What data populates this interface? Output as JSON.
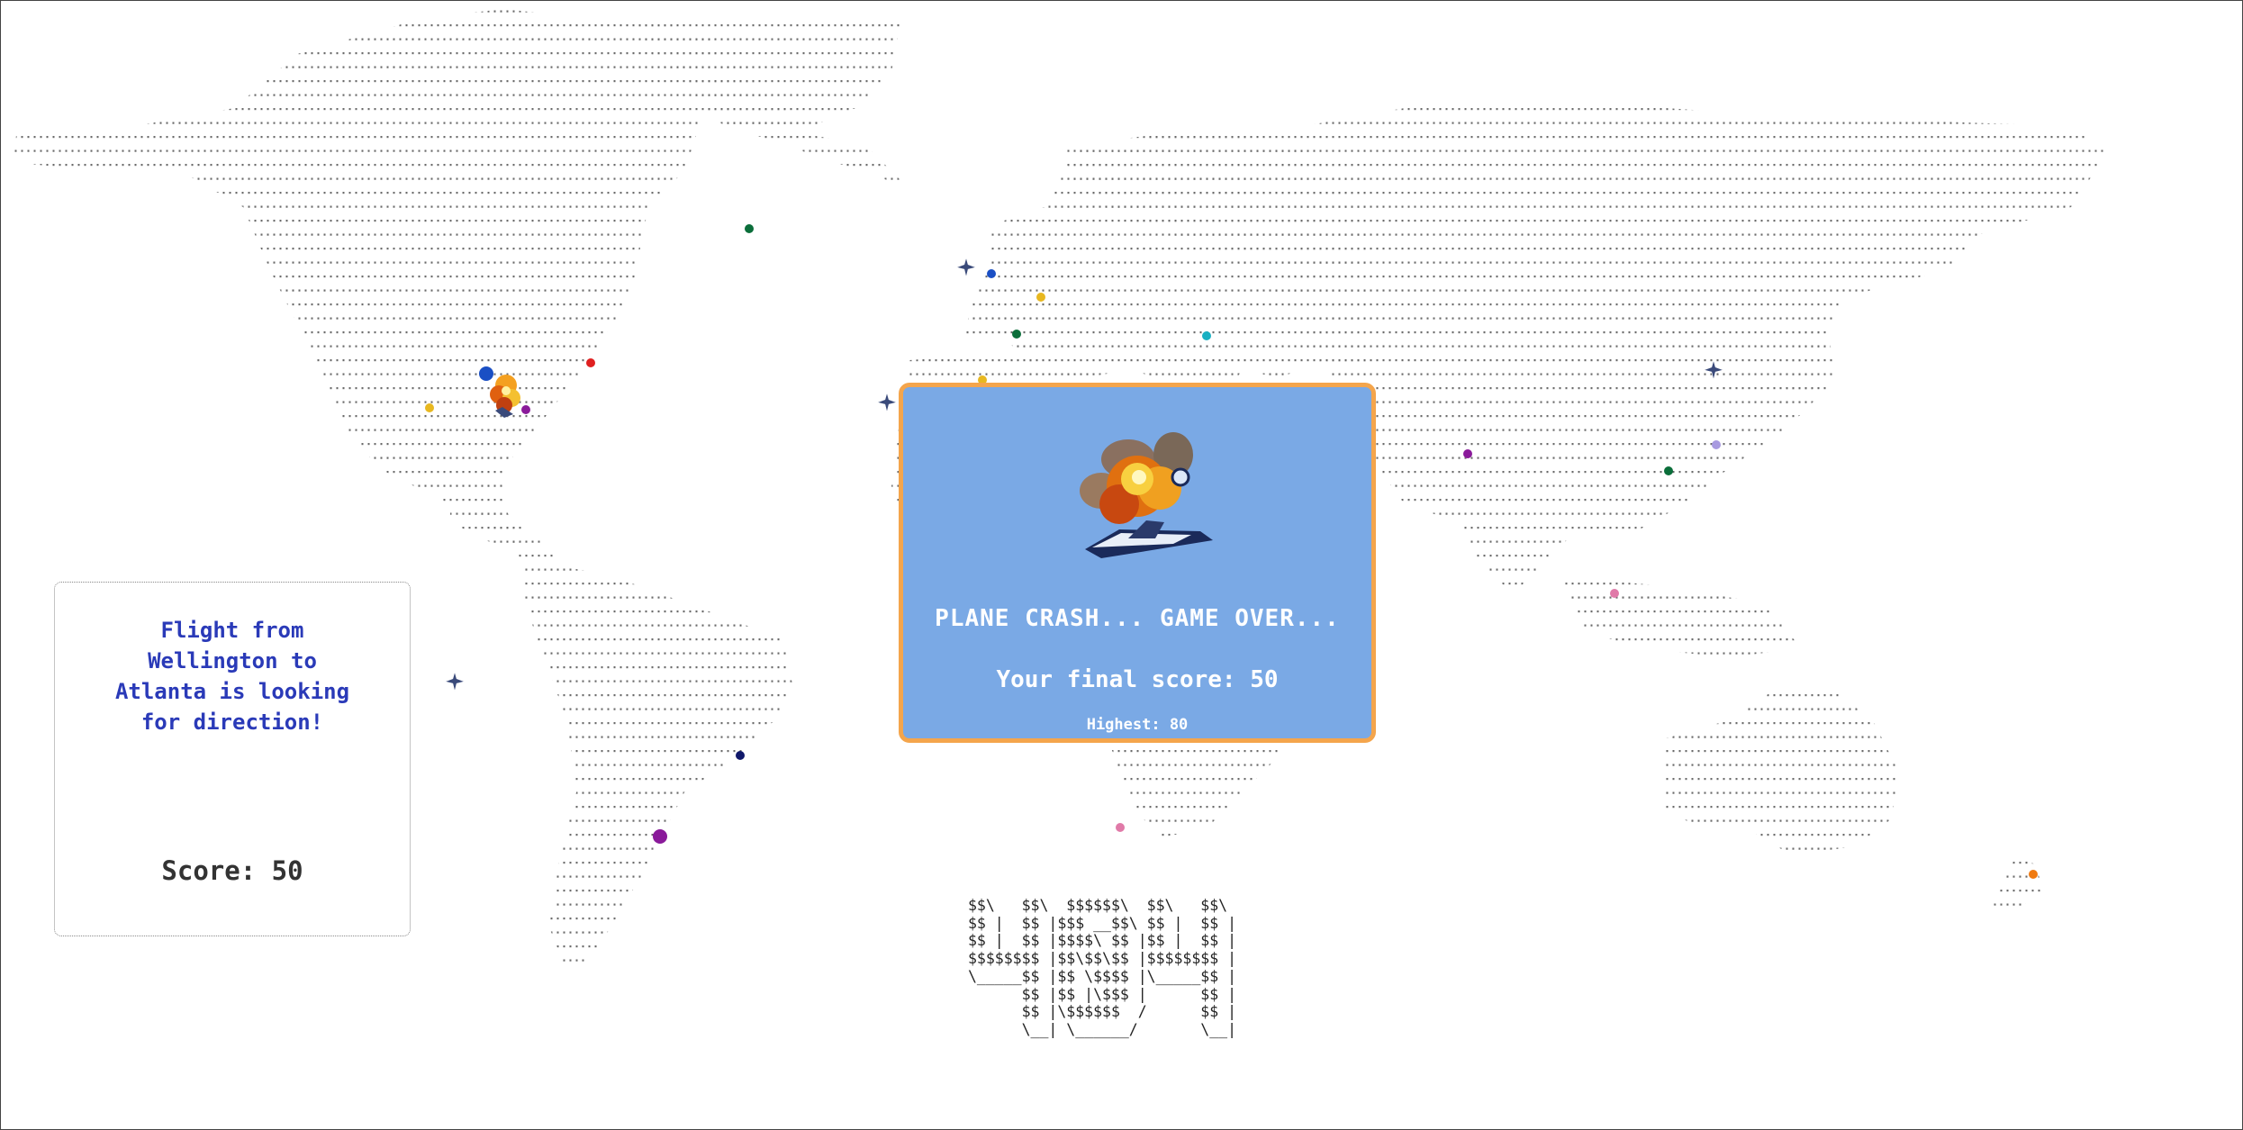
{
  "game": {
    "status_message": "Flight from\nWellington to\nAtlanta is looking\nfor direction!",
    "score_text": "Score: 50",
    "modal_title": "PLANE CRASH... GAME OVER...",
    "final_score_text": "Your final score: 50",
    "highest_text": "Highest: 80",
    "final_score": 50,
    "highest_score": 80
  },
  "ascii_banner": "$$\\   $$\\  $$$$$$\\  $$\\   $$\\\n$$ |  $$ |$$$ __$$\\ $$ |  $$ |\n$$ |  $$ |$$$$\\ $$ |$$ |  $$ |\n$$$$$$$$ |$$\\$$\\$$ |$$$$$$$$ |\n\\_____$$ |$$ \\$$$$ |\\_____$$ |\n      $$ |$$ |\\$$$ |      $$ |\n      $$ |\\$$$$$$  /      $$ |\n      \\__| \\______/       \\__|",
  "airports": [
    {
      "id": "airport-1",
      "color": "#0b6e3a"
    },
    {
      "id": "airport-2",
      "color": "#1a4fc4"
    },
    {
      "id": "airport-3",
      "color": "#e02020"
    },
    {
      "id": "airport-4",
      "color": "#e8b820"
    },
    {
      "id": "airport-5",
      "color": "#8a1a9a"
    },
    {
      "id": "airport-6",
      "color": "#1a4fc4"
    },
    {
      "id": "airport-7",
      "color": "#e8b820"
    },
    {
      "id": "airport-8",
      "color": "#0b6e3a"
    },
    {
      "id": "airport-9",
      "color": "#19b0c2"
    },
    {
      "id": "airport-10",
      "color": "#e8b820"
    },
    {
      "id": "airport-11",
      "color": "#8a1a9a"
    },
    {
      "id": "airport-12",
      "color": "#a89ae0"
    },
    {
      "id": "airport-13",
      "color": "#0b6e3a"
    },
    {
      "id": "airport-14",
      "color": "#e07aa8"
    },
    {
      "id": "airport-15",
      "color": "#10186a"
    },
    {
      "id": "airport-16",
      "color": "#8a1a9a"
    },
    {
      "id": "airport-17",
      "color": "#e07aa8"
    },
    {
      "id": "airport-18",
      "color": "#f07a10"
    }
  ],
  "icons": {
    "plane": "plane-icon",
    "explosion": "explosion-icon"
  },
  "colors": {
    "modal_bg": "#7aa9e5",
    "modal_border": "#f4a54c",
    "message": "#2a3ab8"
  }
}
